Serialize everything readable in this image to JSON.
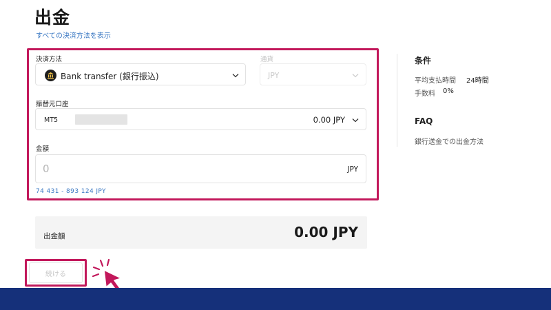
{
  "page": {
    "title": "出金",
    "all_methods_link": "すべての決済方法を表示"
  },
  "form": {
    "method": {
      "label": "決済方法",
      "value": "Bank transfer (銀行振込)",
      "icon": "bank-icon"
    },
    "currency": {
      "label": "通貨",
      "value": "JPY",
      "state": "disabled"
    },
    "account": {
      "label": "振替元口座",
      "account_type": "MT5",
      "balance": "0.00 JPY"
    },
    "amount": {
      "label": "金額",
      "placeholder": "0",
      "unit": "JPY",
      "range_hint": "74 431 - 893 124 JPY"
    }
  },
  "summary": {
    "label": "出金額",
    "amount": "0.00 JPY"
  },
  "actions": {
    "continue_label": "続ける",
    "continue_state": "disabled"
  },
  "sidebar": {
    "conditions_heading": "条件",
    "processing_time_label": "平均支払時間",
    "processing_time_value": "24時間",
    "fee_label": "手数料",
    "fee_value": "0%",
    "faq_heading": "FAQ",
    "faq_link": "銀行送金での出金方法"
  },
  "colors": {
    "highlight": "#c2185b",
    "link": "#3a78c3",
    "footer": "#15307a"
  }
}
